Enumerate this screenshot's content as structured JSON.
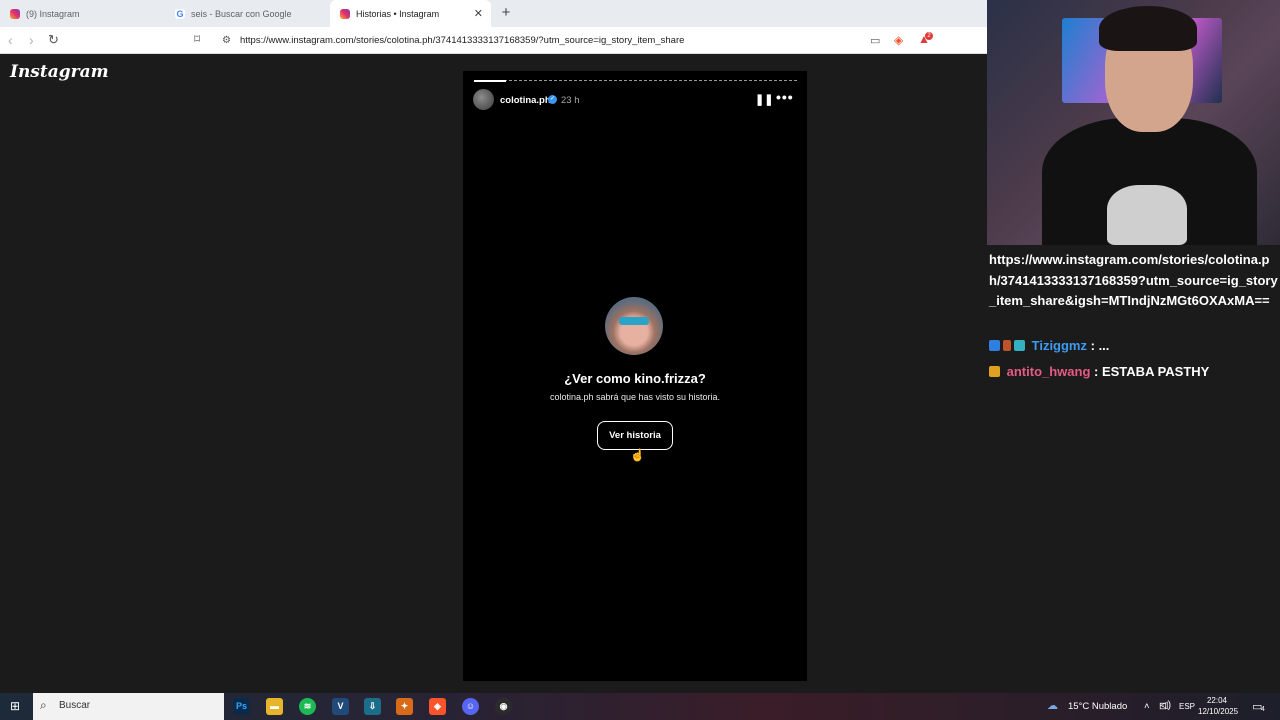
{
  "browser": {
    "tabs": [
      {
        "label": "(9) Instagram",
        "active": false
      },
      {
        "label": "seis - Buscar con Google",
        "active": false
      },
      {
        "label": "Historias • Instagram",
        "active": true
      }
    ],
    "url": "https://www.instagram.com/stories/colotina.ph/3741413333137168359/?utm_source=ig_story_item_share",
    "brave_badge": "2"
  },
  "instagram": {
    "logo": "Instagram",
    "story": {
      "username": "colotina.ph",
      "time": "23 h",
      "prompt_title": "¿Ver como kino.frizza?",
      "prompt_subtitle": "colotina.ph sabrá que has visto su historia.",
      "view_button": "Ver historia",
      "progress": 0.1
    }
  },
  "stream": {
    "chat_url": "https://www.instagram.com/stories/colotina.ph/3741413333137168359?utm_source=ig_story_item_share&igsh=MTIndjNzMGt6OXAxMA==",
    "messages": [
      {
        "user": "Tiziggmz",
        "user_color": "#3d9bf0",
        "separator": " : ",
        "text": "..."
      },
      {
        "user": "antito_hwang",
        "user_color": "#e65a86",
        "separator": " : ",
        "text": "ESTABA PASTHY"
      }
    ]
  },
  "taskbar": {
    "search_placeholder": "Buscar",
    "weather": "15°C  Nublado",
    "language": "ESP",
    "time": "22:04",
    "date": "12/10/2025",
    "notifications": "4"
  },
  "colors": {
    "page_bg": "#1b1b1b",
    "story_bg": "#000000",
    "verified": "#3897f0"
  }
}
